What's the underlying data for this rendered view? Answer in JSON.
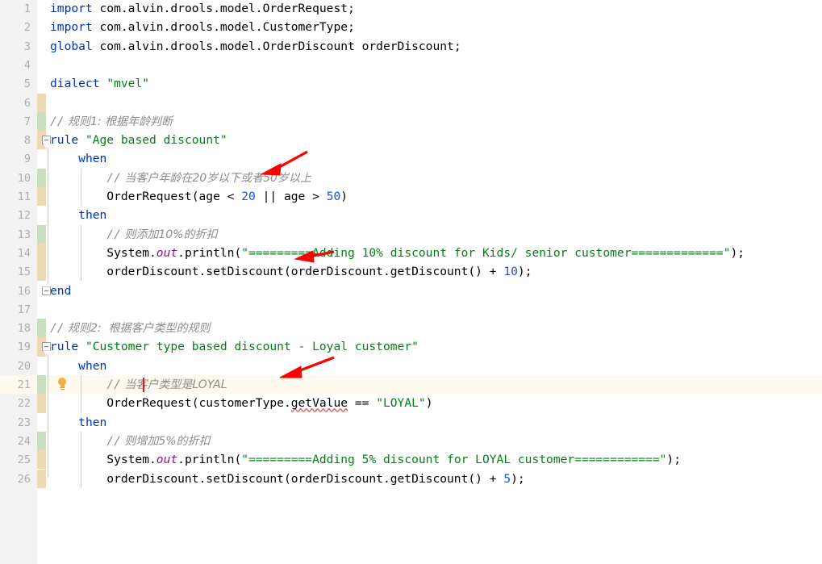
{
  "editor": {
    "language": "drools",
    "theme": "light",
    "colors": {
      "background": "#ffffff",
      "gutter_background": "#f2f2f2",
      "line_number": "#adadad",
      "keyword": "#0033b3",
      "string": "#067d17",
      "number": "#1750eb",
      "comment": "#8c8c8c",
      "static_field": "#871094",
      "vcs_added": "#c9e0c0",
      "vcs_changed": "#ecd9b5",
      "caret": "#e01b1b",
      "highlight_row": "#fdf9ec",
      "annotation_arrow": "#ff0000",
      "error_squiggle": "#e85c5c"
    },
    "caret_line": 21,
    "caret_column": 12,
    "lines": [
      {
        "n": 1,
        "vcs": "none",
        "text": "import com.alvin.drools.model.OrderRequest;"
      },
      {
        "n": 2,
        "vcs": "none",
        "text": "import com.alvin.drools.model.CustomerType;"
      },
      {
        "n": 3,
        "vcs": "none",
        "text": "global com.alvin.drools.model.OrderDiscount orderDiscount;"
      },
      {
        "n": 4,
        "vcs": "none",
        "text": ""
      },
      {
        "n": 5,
        "vcs": "none",
        "text": "dialect \"mvel\""
      },
      {
        "n": 6,
        "vcs": "changed",
        "text": ""
      },
      {
        "n": 7,
        "vcs": "added",
        "text": "// 规则1: 根据年龄判断"
      },
      {
        "n": 8,
        "vcs": "changed",
        "text": "rule \"Age based discount\""
      },
      {
        "n": 9,
        "vcs": "none",
        "text": "    when"
      },
      {
        "n": 10,
        "vcs": "added",
        "text": "        // 当客户年龄在20岁以下或者50岁以上"
      },
      {
        "n": 11,
        "vcs": "changed",
        "text": "        OrderRequest(age < 20 || age > 50)"
      },
      {
        "n": 12,
        "vcs": "none",
        "text": "    then"
      },
      {
        "n": 13,
        "vcs": "added",
        "text": "        // 则添加10%的折扣"
      },
      {
        "n": 14,
        "vcs": "changed",
        "text": "        System.out.println(\"=========Adding 10% discount for Kids/ senior customer=============\");"
      },
      {
        "n": 15,
        "vcs": "changed",
        "text": "        orderDiscount.setDiscount(orderDiscount.getDiscount() + 10);"
      },
      {
        "n": 16,
        "vcs": "none",
        "text": "end"
      },
      {
        "n": 17,
        "vcs": "none",
        "text": ""
      },
      {
        "n": 18,
        "vcs": "added",
        "text": "// 规则2:  根据客户类型的规则"
      },
      {
        "n": 19,
        "vcs": "changed",
        "text": "rule \"Customer type based discount - Loyal customer\""
      },
      {
        "n": 20,
        "vcs": "none",
        "text": "    when"
      },
      {
        "n": 21,
        "vcs": "added",
        "text": "        // 当客户类型是LOYAL"
      },
      {
        "n": 22,
        "vcs": "changed",
        "text": "        OrderRequest(customerType.getValue == \"LOYAL\")"
      },
      {
        "n": 23,
        "vcs": "none",
        "text": "    then"
      },
      {
        "n": 24,
        "vcs": "added",
        "text": "        // 则增加5%的折扣"
      },
      {
        "n": 25,
        "vcs": "changed",
        "text": "        System.out.println(\"=========Adding 5% discount for LOYAL customer============\");"
      },
      {
        "n": 26,
        "vcs": "changed",
        "text": "        orderDiscount.setDiscount(orderDiscount.getDiscount() + 5);"
      }
    ],
    "fold_markers": [
      {
        "line": 8,
        "state": "expanded",
        "direction": "start"
      },
      {
        "line": 16,
        "state": "expanded",
        "direction": "end"
      },
      {
        "line": 19,
        "state": "expanded",
        "direction": "start"
      }
    ],
    "inspection_hint": {
      "line": 21,
      "icon": "lightbulb-icon",
      "tooltip": "Show Context Actions"
    },
    "error_markers": [
      {
        "line": 22,
        "token": "getValue",
        "type": "unresolved-reference"
      }
    ],
    "annotations": [
      {
        "id": "arrow-1",
        "points_to_line": 8,
        "label": ""
      },
      {
        "id": "arrow-2",
        "points_to_line": 13,
        "label": ""
      },
      {
        "id": "arrow-3",
        "points_to_line": 18,
        "label": ""
      }
    ]
  }
}
